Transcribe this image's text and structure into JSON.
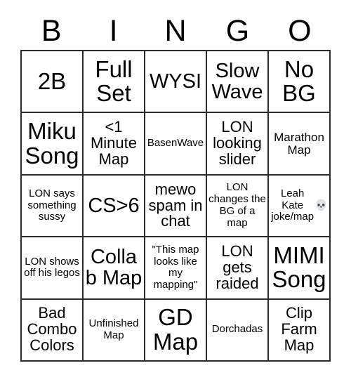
{
  "card": {
    "title": "BINGO",
    "header_letters": [
      "B",
      "I",
      "N",
      "G",
      "O"
    ],
    "border_color": "#2b2b2b",
    "background_color": "#ffffff",
    "text_color": "#000000",
    "rows": [
      [
        {
          "text": "2B",
          "size": "fs-xxl"
        },
        {
          "text": "Full Set",
          "size": "fs-xxl"
        },
        {
          "text": "WYSI",
          "size": "fs-xl"
        },
        {
          "text": "Slow Wave",
          "size": "fs-xl"
        },
        {
          "text": "No BG",
          "size": "fs-xxl"
        }
      ],
      [
        {
          "text": "Miku Song",
          "size": "fs-xxl"
        },
        {
          "text": "<1 Minute Map",
          "size": "fs-md"
        },
        {
          "text": "BasenWave",
          "size": "fs-xs"
        },
        {
          "text": "LON looking slider",
          "size": "fs-md"
        },
        {
          "text": "Marathon Map",
          "size": "fs-sm"
        }
      ],
      [
        {
          "text": "LON says something sussy",
          "size": "fs-xs"
        },
        {
          "text": "CS>6",
          "size": "fs-xl"
        },
        {
          "text": "mewo spam in chat",
          "size": "fs-md"
        },
        {
          "text": "LON changes the BG of a map",
          "size": "fs-xs"
        },
        {
          "text": "Leah Kate joke/map",
          "size": "fs-xs",
          "emoji": "💀"
        }
      ],
      [
        {
          "text": "LON shows off his legos",
          "size": "fs-xs"
        },
        {
          "text": "Collab Map",
          "size": "fs-xl"
        },
        {
          "text": "\"This map looks like my mapping\"",
          "size": "fs-xs"
        },
        {
          "text": "LON gets raided",
          "size": "fs-md"
        },
        {
          "text": "MIMI Song",
          "size": "fs-xxl"
        }
      ],
      [
        {
          "text": "Bad Combo Colors",
          "size": "fs-md"
        },
        {
          "text": "Unfinished Map",
          "size": "fs-xs"
        },
        {
          "text": "GD Map",
          "size": "fs-xxl"
        },
        {
          "text": "Dorchadas",
          "size": "fs-xs"
        },
        {
          "text": "Clip Farm Map",
          "size": "fs-md"
        }
      ]
    ]
  }
}
